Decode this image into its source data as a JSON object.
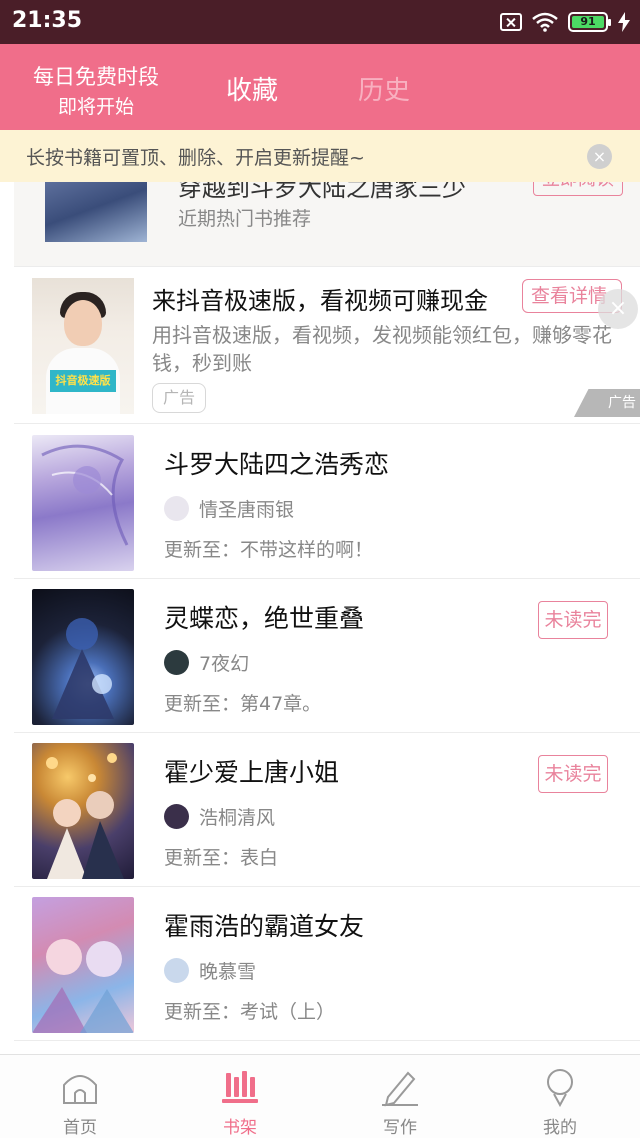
{
  "status_bar": {
    "time": "21:35",
    "battery": "91"
  },
  "header": {
    "free_period_line1": "每日免费时段",
    "free_period_line2": "即将开始",
    "tab_favorites": "收藏",
    "tab_history": "历史"
  },
  "hint": {
    "text": "长按书籍可置顶、删除、开启更新提醒~",
    "close": "×"
  },
  "recommendation": {
    "title": "穿越到斗罗大陆之唐家三少",
    "subtitle": "近期热门书推荐",
    "button": "立即阅读"
  },
  "ad": {
    "title": "来抖音极速版，看视频可赚现金",
    "description": "用抖音极速版，看视频，发视频能领红包，赚够零花钱，秒到账",
    "tag": "广告",
    "detail_button": "查看详情",
    "close": "×",
    "corner_label": "广告",
    "image_banner": "抖音极速版"
  },
  "books": [
    {
      "title": "斗罗大陆四之浩秀恋",
      "author": "情圣唐雨银",
      "update": "更新至：不带这样的啊！",
      "badge": ""
    },
    {
      "title": "灵蝶恋，绝世重叠",
      "author": "7夜幻",
      "update": "更新至：第47章。",
      "badge": "未读完"
    },
    {
      "title": "霍少爱上唐小姐",
      "author": "浩桐清风",
      "update": "更新至：表白",
      "badge": "未读完"
    },
    {
      "title": "霍雨浩的霸道女友",
      "author": "晚慕雪",
      "update": "更新至：考试（上）",
      "badge": ""
    }
  ],
  "nav": {
    "home": "首页",
    "bookshelf": "书架",
    "write": "写作",
    "mine": "我的"
  },
  "colors": {
    "accent": "#f06e8a",
    "badge": "#e9839c",
    "status_bar": "#4a1e28",
    "hint_bg": "#fdf3d4"
  }
}
